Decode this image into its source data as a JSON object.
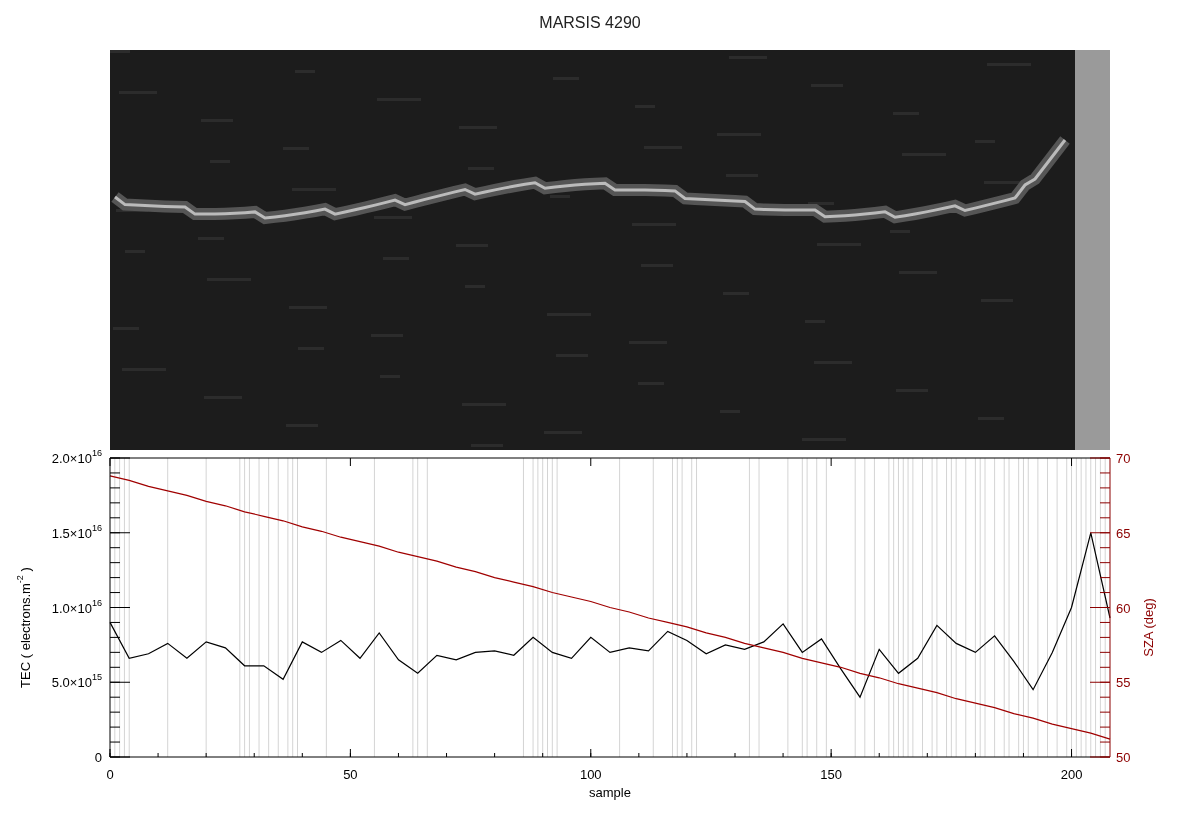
{
  "title": "MARSIS 4290",
  "chart": {
    "chart_data": {
      "type": "line",
      "xlabel": "sample",
      "ylabel": "TEC ( electrons.m$^{-2}$ )",
      "y2label": "SZA (deg)",
      "xlim": [
        0,
        208
      ],
      "ylim": [
        0,
        2e+16
      ],
      "y2lim": [
        50,
        70
      ],
      "xticks": [
        0,
        50,
        100,
        150,
        200
      ],
      "yticks": [
        {
          "value": 0,
          "label": "0"
        },
        {
          "value": 5000000000000000.0,
          "label": "5.0×10$^{15}$"
        },
        {
          "value": 1e+16,
          "label": "1.0×10$^{16}$"
        },
        {
          "value": 1.5e+16,
          "label": "1.5×10$^{16}$"
        },
        {
          "value": 2e+16,
          "label": "2.0×10$^{16}$"
        }
      ],
      "y2ticks": [
        50,
        55,
        60,
        65,
        70
      ],
      "x": [
        0,
        4,
        8,
        12,
        16,
        20,
        24,
        28,
        32,
        36,
        40,
        44,
        48,
        52,
        56,
        60,
        64,
        68,
        72,
        76,
        80,
        84,
        88,
        92,
        96,
        100,
        104,
        108,
        112,
        116,
        120,
        124,
        128,
        132,
        136,
        140,
        144,
        148,
        152,
        156,
        160,
        164,
        168,
        172,
        176,
        180,
        184,
        188,
        192,
        196,
        200,
        204,
        208
      ],
      "series": [
        {
          "color": "#000000",
          "values": [
            9000000000000000.0,
            6600000000000000.0,
            6900000000000000.0,
            7600000000000000.0,
            6600000000000000.0,
            7700000000000000.0,
            7300000000000000.0,
            6100000000000000.0,
            6100000000000000.0,
            5200000000000000.0,
            7700000000000000.0,
            7000000000000000.0,
            7800000000000000.0,
            6600000000000000.0,
            8300000000000000.0,
            6500000000000000.0,
            5600000000000000.0,
            6800000000000000.0,
            6500000000000000.0,
            7000000000000000.0,
            7100000000000000.0,
            6800000000000000.0,
            8000000000000000.0,
            7000000000000000.0,
            6600000000000000.0,
            8000000000000000.0,
            7000000000000000.0,
            7300000000000000.0,
            7100000000000000.0,
            8400000000000000.0,
            7800000000000000.0,
            6900000000000000.0,
            7500000000000000.0,
            7200000000000000.0,
            7700000000000000.0,
            8900000000000000.0,
            7000000000000000.0,
            7900000000000000.0,
            5900000000000000.0,
            4000000000000000.0,
            7200000000000000.0,
            5600000000000000.0,
            6600000000000000.0,
            8800000000000000.0,
            7600000000000000.0,
            7000000000000000.0,
            8100000000000000.0,
            6400000000000000.0,
            4500000000000000.0,
            7000000000000000.0,
            1e+16,
            1.5e+16,
            9300000000000000.0
          ]
        },
        {
          "color": "#a00000",
          "axis": "y2",
          "values": [
            68.8,
            68.5,
            68.1,
            67.8,
            67.5,
            67.1,
            66.8,
            66.4,
            66.1,
            65.8,
            65.4,
            65.1,
            64.7,
            64.4,
            64.1,
            63.7,
            63.4,
            63.1,
            62.7,
            62.4,
            62.0,
            61.7,
            61.4,
            61.0,
            60.7,
            60.4,
            60.0,
            59.7,
            59.3,
            59.0,
            58.7,
            58.3,
            58.0,
            57.6,
            57.3,
            57.0,
            56.6,
            56.3,
            56.0,
            55.6,
            55.3,
            54.9,
            54.6,
            54.3,
            53.9,
            53.6,
            53.3,
            52.9,
            52.6,
            52.2,
            51.9,
            51.6,
            51.2
          ]
        }
      ],
      "ref_lines": [
        {
          "axis": "x",
          "value": 1
        },
        {
          "axis": "x",
          "value": 2
        },
        {
          "axis": "x",
          "value": 3
        },
        {
          "axis": "x",
          "value": 4
        },
        {
          "axis": "x",
          "value": 12
        },
        {
          "axis": "x",
          "value": 20
        },
        {
          "axis": "x",
          "value": 27
        },
        {
          "axis": "x",
          "value": 28
        },
        {
          "axis": "x",
          "value": 29
        },
        {
          "axis": "x",
          "value": 31
        },
        {
          "axis": "x",
          "value": 33
        },
        {
          "axis": "x",
          "value": 35
        },
        {
          "axis": "x",
          "value": 37
        },
        {
          "axis": "x",
          "value": 38
        },
        {
          "axis": "x",
          "value": 39
        },
        {
          "axis": "x",
          "value": 45
        },
        {
          "axis": "x",
          "value": 55
        },
        {
          "axis": "x",
          "value": 63
        },
        {
          "axis": "x",
          "value": 64
        },
        {
          "axis": "x",
          "value": 66
        },
        {
          "axis": "x",
          "value": 86
        },
        {
          "axis": "x",
          "value": 88
        },
        {
          "axis": "x",
          "value": 89
        },
        {
          "axis": "x",
          "value": 90
        },
        {
          "axis": "x",
          "value": 91
        },
        {
          "axis": "x",
          "value": 92
        },
        {
          "axis": "x",
          "value": 93
        },
        {
          "axis": "x",
          "value": 106
        },
        {
          "axis": "x",
          "value": 113
        },
        {
          "axis": "x",
          "value": 117
        },
        {
          "axis": "x",
          "value": 118
        },
        {
          "axis": "x",
          "value": 119
        },
        {
          "axis": "x",
          "value": 121
        },
        {
          "axis": "x",
          "value": 122
        },
        {
          "axis": "x",
          "value": 133
        },
        {
          "axis": "x",
          "value": 135
        },
        {
          "axis": "x",
          "value": 141
        },
        {
          "axis": "x",
          "value": 144
        },
        {
          "axis": "x",
          "value": 145
        },
        {
          "axis": "x",
          "value": 147
        },
        {
          "axis": "x",
          "value": 149
        },
        {
          "axis": "x",
          "value": 155
        },
        {
          "axis": "x",
          "value": 157
        },
        {
          "axis": "x",
          "value": 159
        },
        {
          "axis": "x",
          "value": 162
        },
        {
          "axis": "x",
          "value": 163
        },
        {
          "axis": "x",
          "value": 164
        },
        {
          "axis": "x",
          "value": 165
        },
        {
          "axis": "x",
          "value": 166
        },
        {
          "axis": "x",
          "value": 167
        },
        {
          "axis": "x",
          "value": 169
        },
        {
          "axis": "x",
          "value": 171
        },
        {
          "axis": "x",
          "value": 172
        },
        {
          "axis": "x",
          "value": 174
        },
        {
          "axis": "x",
          "value": 175
        },
        {
          "axis": "x",
          "value": 176
        },
        {
          "axis": "x",
          "value": 178
        },
        {
          "axis": "x",
          "value": 180
        },
        {
          "axis": "x",
          "value": 181
        },
        {
          "axis": "x",
          "value": 182
        },
        {
          "axis": "x",
          "value": 184
        },
        {
          "axis": "x",
          "value": 186
        },
        {
          "axis": "x",
          "value": 187
        },
        {
          "axis": "x",
          "value": 189
        },
        {
          "axis": "x",
          "value": 190
        },
        {
          "axis": "x",
          "value": 191
        },
        {
          "axis": "x",
          "value": 193
        },
        {
          "axis": "x",
          "value": 195
        },
        {
          "axis": "x",
          "value": 197
        },
        {
          "axis": "x",
          "value": 199
        },
        {
          "axis": "x",
          "value": 200
        },
        {
          "axis": "x",
          "value": 201
        },
        {
          "axis": "x",
          "value": 202
        },
        {
          "axis": "x",
          "value": 203
        },
        {
          "axis": "x",
          "value": 204
        },
        {
          "axis": "x",
          "value": 205
        },
        {
          "axis": "x",
          "value": 206
        },
        {
          "axis": "x",
          "value": 207
        }
      ]
    }
  }
}
